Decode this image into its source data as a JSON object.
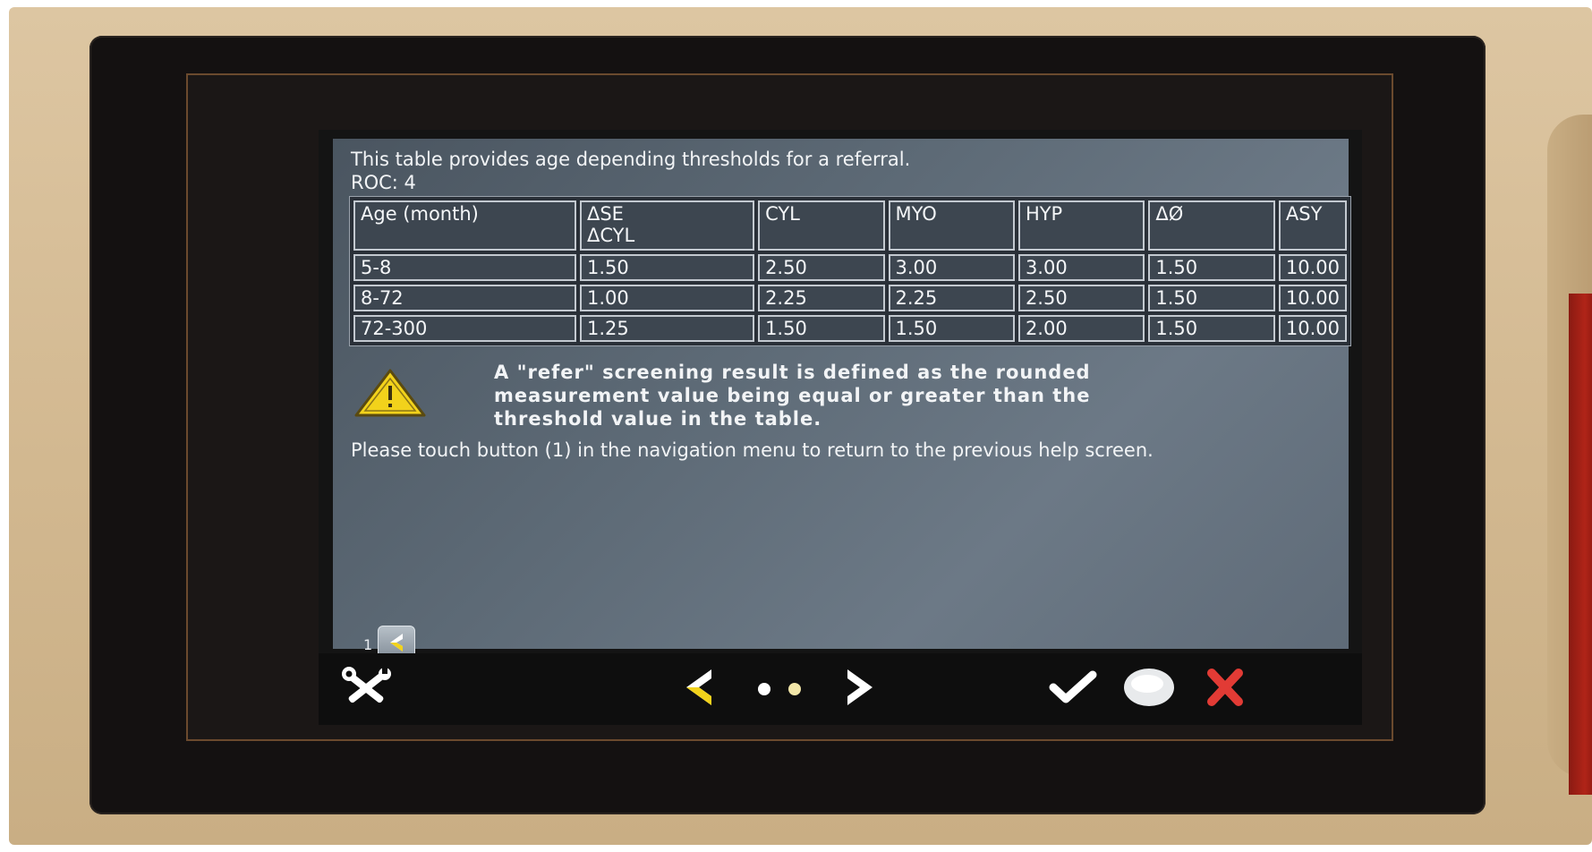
{
  "screen": {
    "intro_line1": "This table provides age depending thresholds for a referral.",
    "intro_line2": "ROC: 4"
  },
  "table": {
    "headers": [
      [
        "Age (month)"
      ],
      [
        "ΔSE",
        "ΔCYL"
      ],
      [
        "CYL"
      ],
      [
        "MYO"
      ],
      [
        "HYP"
      ],
      [
        "ΔØ"
      ],
      [
        "ASY"
      ]
    ],
    "rows": [
      [
        "5-8",
        "1.50",
        "2.50",
        "3.00",
        "3.00",
        "1.50",
        "10.00"
      ],
      [
        "8-72",
        "1.00",
        "2.25",
        "2.25",
        "2.50",
        "1.50",
        "10.00"
      ],
      [
        "72-300",
        "1.25",
        "1.50",
        "1.50",
        "2.00",
        "1.50",
        "10.00"
      ]
    ]
  },
  "warning": {
    "line1": "A \"refer\" screening result is defined as the rounded",
    "line2": "measurement value being equal or greater than the",
    "line3": "threshold value in the table."
  },
  "help": {
    "text": "Please touch button (1) in the navigation menu to return to the previous help screen."
  },
  "page_back": {
    "number": "1"
  },
  "icons": {
    "warning": "warning-triangle-icon",
    "back": "chevron-left-icon",
    "settings": "tools-icon",
    "prev": "chevron-left-icon",
    "next": "chevron-right-icon",
    "confirm": "checkmark-icon",
    "status": "circle-icon",
    "cancel": "close-icon"
  },
  "colors": {
    "accent_yellow": "#f2d21b",
    "cancel_red": "#e23b35",
    "screen_bg": "#5d6a76",
    "text": "#f2f4f6"
  }
}
